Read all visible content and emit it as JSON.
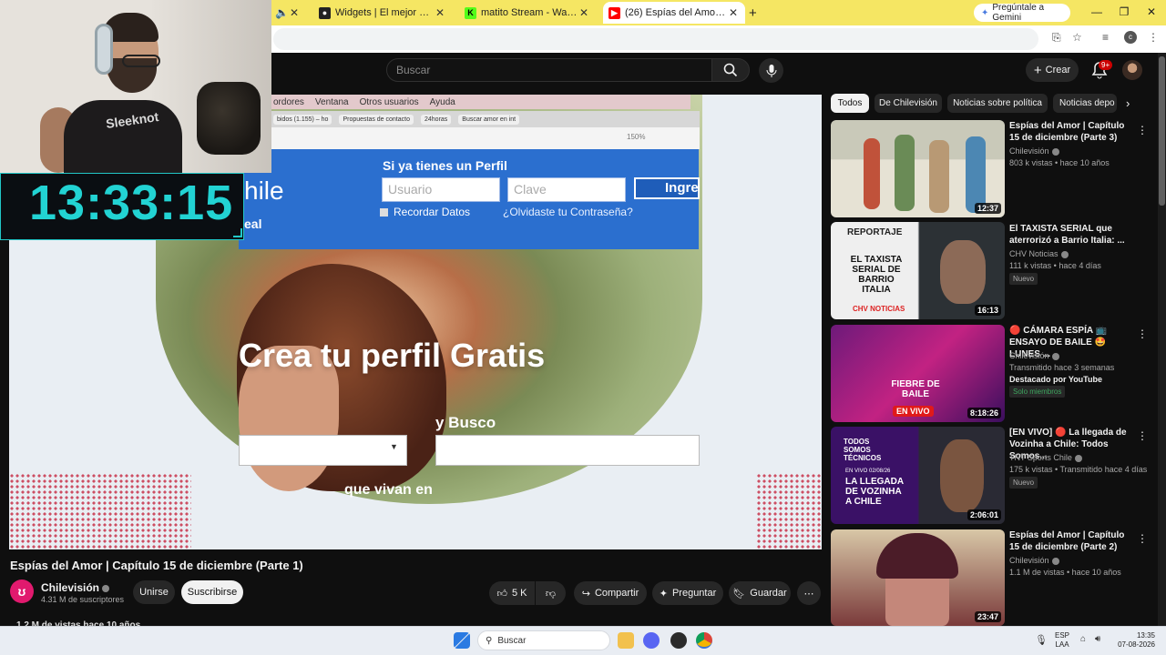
{
  "browser": {
    "tabs": [
      {
        "title": "Widgets | El mejor software pa",
        "favicon": "github-icon"
      },
      {
        "title": "matito Stream - Watch Live on",
        "favicon": "kick-icon"
      },
      {
        "title": "(26) Espías del Amor | Capítulo",
        "favicon": "youtube-icon",
        "active": true
      }
    ],
    "gemini_label": "Pregúntale a Gemini",
    "new_tab": "+"
  },
  "youtube": {
    "search_placeholder": "Buscar",
    "create_label": "Crear",
    "notifications_badge": "9+",
    "chips": [
      "Todos",
      "De Chilevisión",
      "Noticias sobre política",
      "Noticias depo"
    ],
    "video": {
      "title": "Espías del Amor | Capítulo 15 de diciembre (Parte 1)",
      "channel": "Chilevisión",
      "subscribers": "4.31 M de suscriptores",
      "join_label": "Unirse",
      "subscribe_label": "Suscribirse",
      "likes": "5 K",
      "share_label": "Compartir",
      "ask_label": "Preguntar",
      "save_label": "Guardar",
      "views_line": "1,2 M de vistas  hace 10 años",
      "frame": {
        "menu_items": [
          "ordores",
          "Ventana",
          "Otros usuarios",
          "Ayuda"
        ],
        "tabs": [
          "bidos (1.155) – ho",
          "Propuestas de contacto",
          "24horas",
          "Buscar amor en int"
        ],
        "zoom": "150%",
        "logo_text": "hile",
        "logo_sub": "eal",
        "perfil_title": "Si ya tienes un Perfil",
        "user_placeholder": "Usuario",
        "pass_placeholder": "Clave",
        "login_button": "Ingre",
        "remember": "Recordar Datos",
        "forgot": "¿Olvidaste tu Contraseña?",
        "headline": "Crea tu perfil Gratis",
        "busco": "y Busco",
        "vivan": "que vivan en"
      }
    },
    "recommendations": [
      {
        "title": "Espías del Amor | Capítulo 15 de diciembre (Parte 3)",
        "channel": "Chilevisión",
        "meta": "803 k vistas • hace 10 años",
        "duration": "12:37",
        "badge": ""
      },
      {
        "title": "El TAXISTA SERIAL que aterrorizó a Barrio Italia: ...",
        "channel": "CHV Noticias",
        "meta": "111 k vistas • hace 4 días",
        "duration": "16:13",
        "badge": "Nuevo",
        "thumb_text": [
          "REPORTAJE",
          "EL TAXISTA SERIAL DE BARRIO ITALIA",
          "CHV NOTICIAS"
        ]
      },
      {
        "title": "🔴 CÁMARA ESPÍA 📺 ENSAYO DE BAILE 🤩 LUNES ...",
        "channel": "Chilevisión",
        "meta": "Transmitido hace 3 semanas",
        "extra": "Destacado por YouTube",
        "members": "Solo miembros",
        "duration": "8:18:26",
        "thumb_text": [
          "FIEBRE DE BAILE",
          "EN VIVO"
        ]
      },
      {
        "title": "[EN VIVO] 🔴 La llegada de Vozinha a Chile: Todos Somos...",
        "channel": "TNT Sports Chile",
        "meta": "175 k vistas • Transmitido hace 4 días",
        "duration": "2:06:01",
        "badge": "Nuevo",
        "thumb_text": [
          "TODOS SOMOS TÉCNICOS",
          "EN VIVO 02/08/26",
          "LA LLEGADA DE VOZINHA A CHILE"
        ]
      },
      {
        "title": "Espías del Amor | Capítulo 15 de diciembre (Parte 2)",
        "channel": "Chilevisión",
        "meta": "1.1 M de vistas • hace 10 años",
        "duration": "23:47",
        "badge": ""
      }
    ]
  },
  "overlay": {
    "timer": "13:33:15",
    "shirt_text": "Sleeknot"
  },
  "taskbar": {
    "search_label": "Buscar",
    "lang_top": "ESP",
    "lang_bottom": "LAA",
    "time": "13:35",
    "date": "07-08-2026"
  },
  "colors": {
    "tabstrip": "#f5e663",
    "youtube_bg": "#0f0f0f",
    "timer": "#22d3d3",
    "chilevision": "#e11a6e"
  }
}
